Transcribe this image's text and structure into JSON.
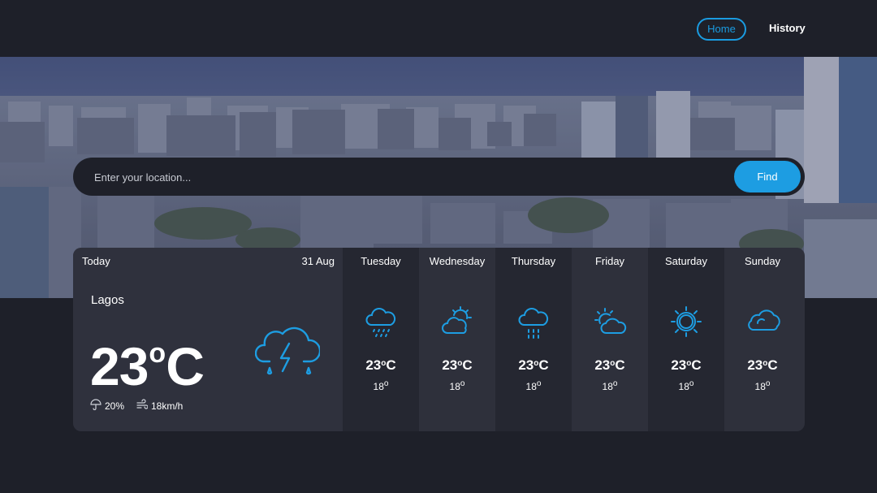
{
  "nav": {
    "home": "Home",
    "history": "History"
  },
  "search": {
    "placeholder": "Enter your location...",
    "button": "Find"
  },
  "today": {
    "label": "Today",
    "date": "31 Aug",
    "city": "Lagos",
    "temp": "23",
    "temp_unit": "C",
    "condition_icon": "thunderstorm-icon",
    "rain": "20%",
    "wind": "18km/h"
  },
  "forecast": [
    {
      "day": "Tuesday",
      "high": "23",
      "unit": "C",
      "low": "18",
      "icon": "rain-cloud-icon"
    },
    {
      "day": "Wednesday",
      "high": "23",
      "unit": "C",
      "low": "18",
      "icon": "sun-behind-cloud-icon"
    },
    {
      "day": "Thursday",
      "high": "23",
      "unit": "C",
      "low": "18",
      "icon": "rain-cloud-icon"
    },
    {
      "day": "Friday",
      "high": "23",
      "unit": "C",
      "low": "18",
      "icon": "partly-cloudy-icon"
    },
    {
      "day": "Saturday",
      "high": "23",
      "unit": "C",
      "low": "18",
      "icon": "sun-icon"
    },
    {
      "day": "Sunday",
      "high": "23",
      "unit": "C",
      "low": "18",
      "icon": "cloud-icon"
    }
  ],
  "colors": {
    "accent": "#1d9de2",
    "background": "#1e2029",
    "panel": "#2e303b",
    "panel_dark": "#252731"
  }
}
